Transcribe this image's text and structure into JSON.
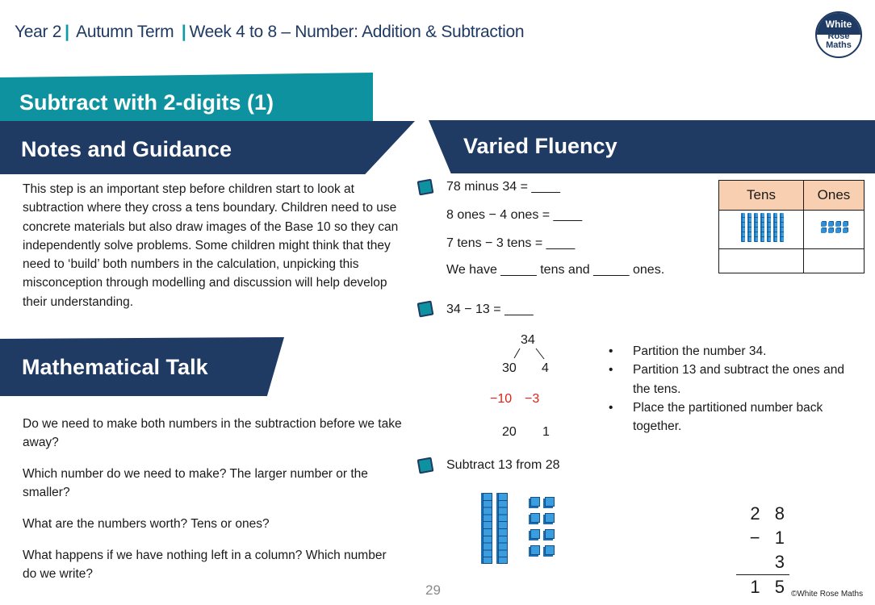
{
  "header": {
    "year": "Year 2",
    "term": "Autumn Term",
    "unit": "Week 4 to 8 – Number: Addition & Subtraction",
    "logo": {
      "line1": "White",
      "line2": "Rose",
      "line3": "Maths"
    }
  },
  "lesson_title": "Subtract with 2-digits (1)",
  "sections": {
    "notes_title": "Notes and Guidance",
    "fluency_title": "Varied Fluency",
    "talk_title": "Mathematical Talk"
  },
  "notes_text": "This step is an important step before children start to look at subtraction where they cross a tens boundary. Children need to use concrete materials but also draw images of the Base 10 so they can independently solve problems. Some children might think that they need to ‘build’ both numbers in the calculation, unpicking this misconception through modelling and discussion will help develop their understanding.",
  "talk_questions": [
    "Do we need to make both numbers in the subtraction before we take away?",
    "Which number do we need to make? The larger number or the smaller?",
    "What are the numbers worth? Tens or ones?",
    "What happens if we have nothing left in a column? Which number do we write?"
  ],
  "fluency": {
    "q1": {
      "lines": [
        "78 minus 34 = ____",
        "8 ones − 4 ones = ____",
        "7 tens − 3 tens = ____",
        "We have _____ tens and _____ ones."
      ],
      "table": {
        "headers": [
          "Tens",
          "Ones"
        ],
        "tens_rods": 7,
        "ones_cubes": 8
      }
    },
    "q2": {
      "prompt": "34 − 13 = ____",
      "partition": {
        "whole": "34",
        "tens": "30",
        "ones": "4",
        "subtract_tens": "−10",
        "subtract_ones": "−3",
        "result_tens": "20",
        "result_ones": "1"
      },
      "bullets": [
        "Partition the number 34.",
        "Partition 13 and subtract the ones and the tens.",
        "Place the partitioned number back together."
      ]
    },
    "q3": {
      "prompt": "Subtract 13 from 28",
      "tens_rods": 2,
      "ones_cubes": 8,
      "column": {
        "top": "2 8",
        "sub": "− 1 3",
        "answer": "1 5"
      }
    }
  },
  "footer": {
    "page_number": "29",
    "copyright": "©White Rose Maths"
  },
  "colors": {
    "navy": "#1f3a63",
    "teal": "#0e929f",
    "table_header": "#f8cfb0",
    "red": "#e0211b",
    "block_blue": "#3a9de0"
  }
}
